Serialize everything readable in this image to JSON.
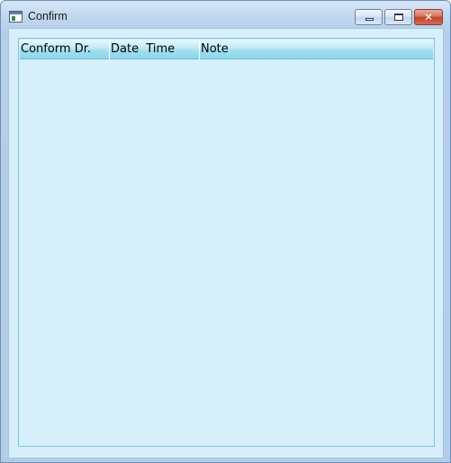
{
  "window": {
    "title": "Confirm",
    "icon": "app-window-icon"
  },
  "caption_buttons": {
    "minimize_icon": "minimize-icon",
    "maximize_icon": "maximize-icon",
    "close_glyph": "✕"
  },
  "listview": {
    "columns": [
      "Conform Dr.",
      "Date  Time",
      "Note"
    ],
    "rows": []
  },
  "colors": {
    "client_background": "#d6effb",
    "header_gradient_top": "#e9f8fd",
    "header_gradient_bottom": "#8ed6ea",
    "close_button": "#c2442a"
  }
}
